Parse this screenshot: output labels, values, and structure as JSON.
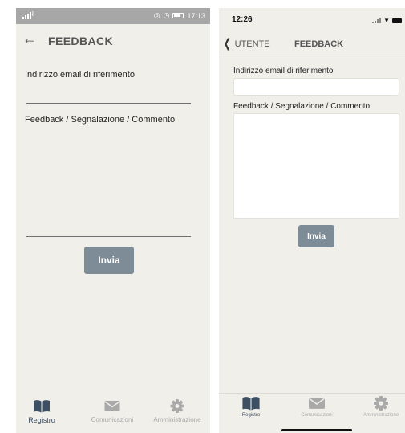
{
  "colors": {
    "background": "#f1efea",
    "accent": "#3d4f62",
    "button": "#7d8c97",
    "inactive_tab": "#a9a9a9",
    "android_status_bar": "#a7a7a7"
  },
  "android": {
    "status_bar": {
      "time": "17:13",
      "icons": [
        "signal-icon",
        "wifi-icon",
        "vibrate-icon",
        "alarm-icon",
        "battery-icon"
      ]
    },
    "header": {
      "back_icon": "arrow-left-icon",
      "title": "FEEDBACK"
    },
    "form": {
      "email_label": "Indirizzo email di riferimento",
      "email_value": "",
      "feedback_label": "Feedback / Segnalazione / Commento",
      "feedback_value": "",
      "submit_label": "Invia"
    },
    "tabs": [
      {
        "label": "Registro",
        "icon": "book-icon",
        "active": true
      },
      {
        "label": "Comunicazioni",
        "icon": "envelope-icon",
        "active": false
      },
      {
        "label": "Amministrazione",
        "icon": "gear-icon",
        "active": false
      }
    ]
  },
  "ios": {
    "status_bar": {
      "time": "12:26",
      "icons": [
        "signal-icon",
        "wifi-icon",
        "battery-icon"
      ]
    },
    "header": {
      "back_icon": "chevron-left-icon",
      "back_label": "UTENTE",
      "title": "FEEDBACK"
    },
    "form": {
      "email_label": "Indirizzo email di riferimento",
      "email_value": "",
      "feedback_label": "Feedback / Segnalazione / Commento",
      "feedback_value": "",
      "submit_label": "Invia"
    },
    "tabs": [
      {
        "label": "Registro",
        "icon": "book-icon",
        "active": true
      },
      {
        "label": "Comunicazioni",
        "icon": "envelope-icon",
        "active": false
      },
      {
        "label": "Amministrazione",
        "icon": "gear-icon",
        "active": false
      }
    ]
  }
}
